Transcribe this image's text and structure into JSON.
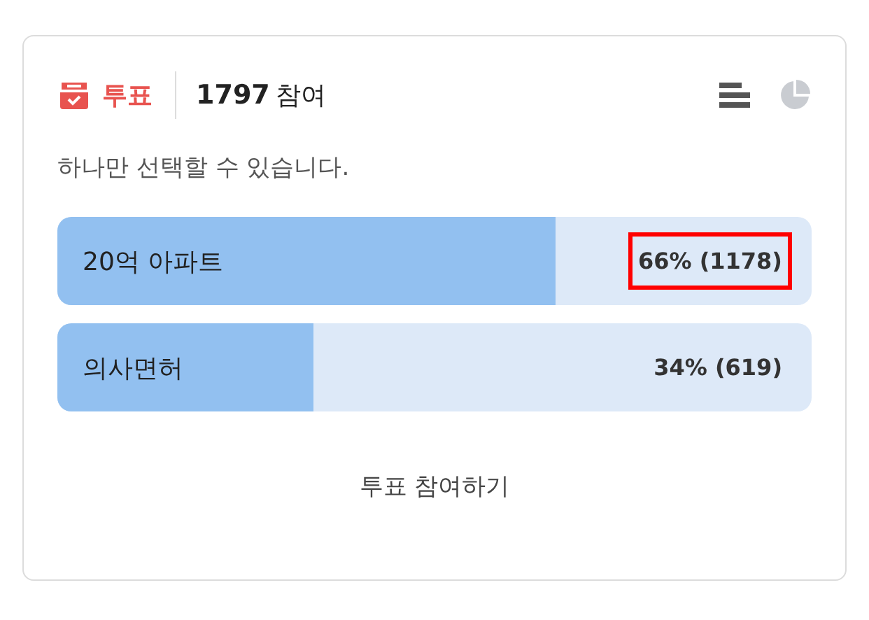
{
  "poll": {
    "label": "투표",
    "count": "1797",
    "count_suffix": "참여",
    "views": [
      {
        "kind": "bar",
        "selected": true
      },
      {
        "kind": "pie",
        "selected": false
      }
    ],
    "hint": "하나만 선택할 수 있습니다.",
    "options": [
      {
        "label": "20억 아파트",
        "result": "66% (1178)",
        "level": 0.66,
        "highlighted": true
      },
      {
        "label": "의사면허",
        "result": "34% (619)",
        "level": 0.34,
        "highlighted": false
      }
    ],
    "action": "투표 참여하기"
  }
}
